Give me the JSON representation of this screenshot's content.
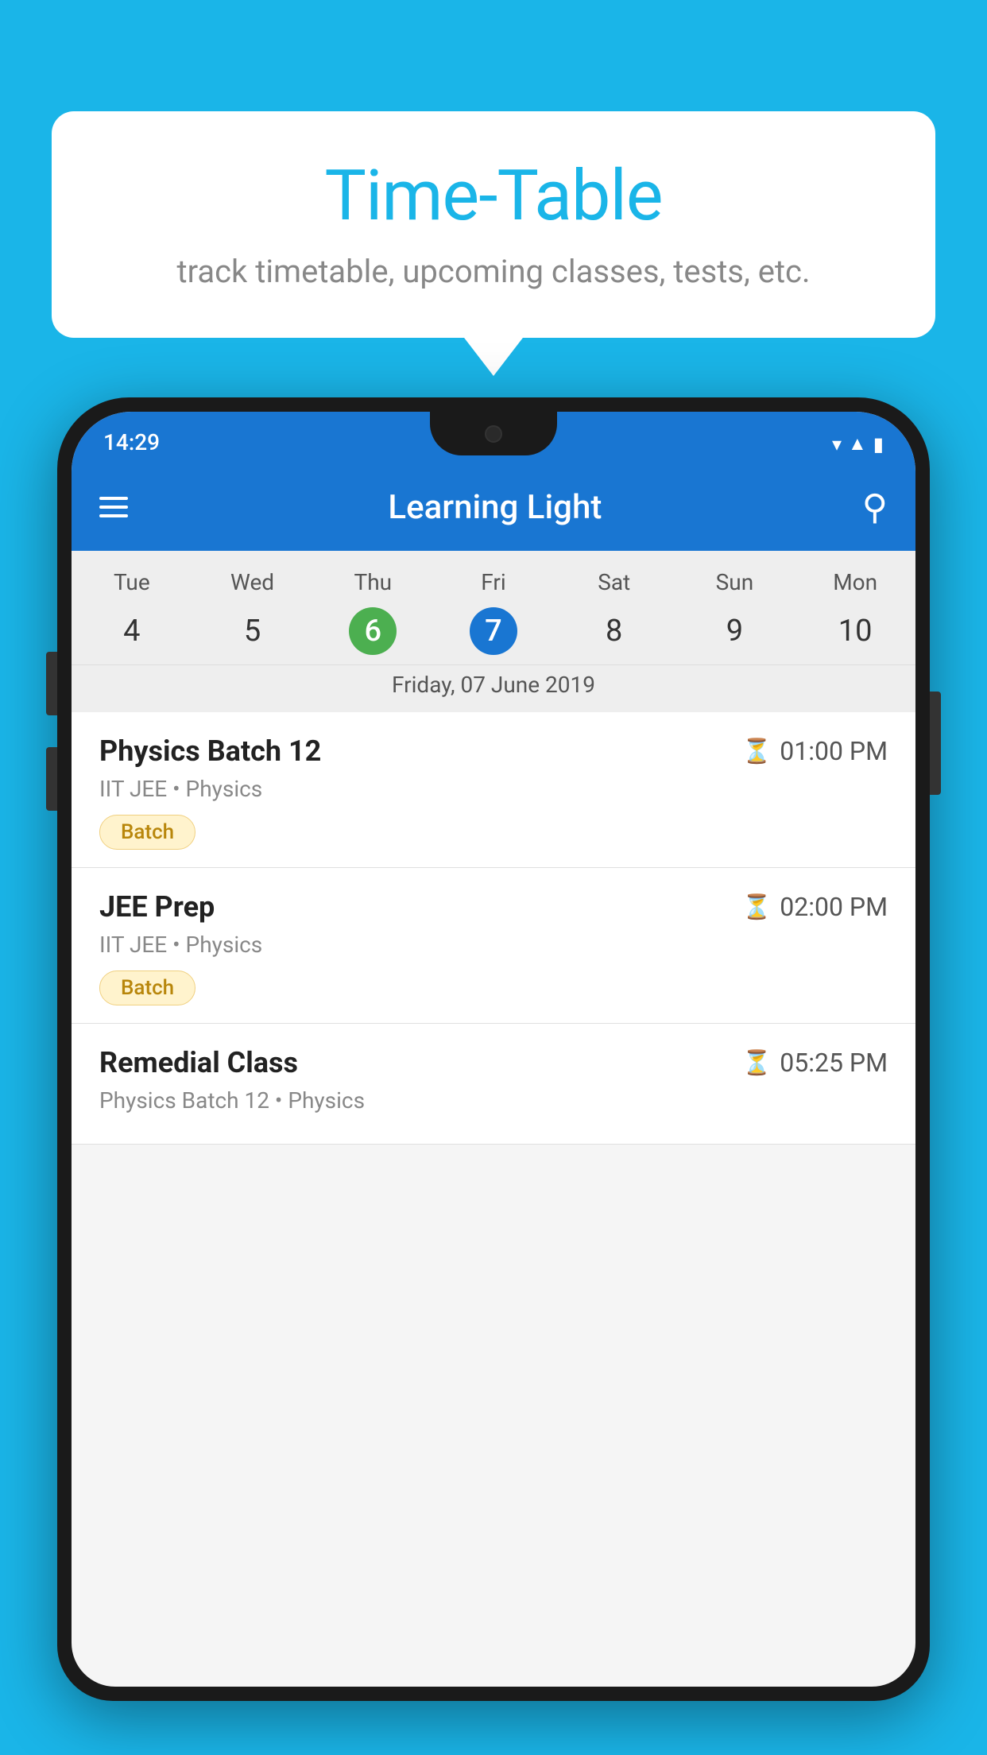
{
  "background_color": "#1ab5e8",
  "speech_bubble": {
    "title": "Time-Table",
    "subtitle": "track timetable, upcoming classes, tests, etc."
  },
  "phone": {
    "status_bar": {
      "time": "14:29"
    },
    "app_bar": {
      "title": "Learning Light"
    },
    "calendar": {
      "days": [
        "Tue",
        "Wed",
        "Thu",
        "Fri",
        "Sat",
        "Sun",
        "Mon"
      ],
      "dates": [
        "4",
        "5",
        "6",
        "7",
        "8",
        "9",
        "10"
      ],
      "today_index": 2,
      "selected_index": 3,
      "selected_date_label": "Friday, 07 June 2019"
    },
    "schedule": [
      {
        "name": "Physics Batch 12",
        "time": "01:00 PM",
        "meta": "IIT JEE • Physics",
        "badge": "Batch"
      },
      {
        "name": "JEE Prep",
        "time": "02:00 PM",
        "meta": "IIT JEE • Physics",
        "badge": "Batch"
      },
      {
        "name": "Remedial Class",
        "time": "05:25 PM",
        "meta": "Physics Batch 12 • Physics",
        "badge": null
      }
    ]
  }
}
